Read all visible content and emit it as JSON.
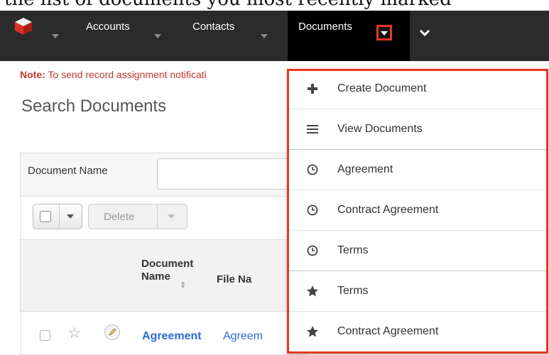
{
  "doc_text": "the list of documents you most recently marked",
  "nav": {
    "items": [
      "Accounts",
      "Contacts",
      "Documents"
    ]
  },
  "note": {
    "bold": "Note:",
    "text": " To send record assignment notificati"
  },
  "page_title": "Search Documents",
  "filter": {
    "label": "Document Name",
    "value": ""
  },
  "actions": {
    "delete_label": "Delete"
  },
  "table": {
    "headers": [
      "Document Name",
      "File Na"
    ],
    "rows": [
      {
        "name": "Agreement",
        "file": "Agreem"
      }
    ]
  },
  "menu": {
    "items": [
      {
        "label": "Create Document",
        "icon": "plus-icon"
      },
      {
        "label": "View Documents",
        "icon": "list-icon"
      },
      {
        "label": "Agreement",
        "icon": "clock-icon"
      },
      {
        "label": "Contract Agreement",
        "icon": "clock-icon"
      },
      {
        "label": "Terms",
        "icon": "clock-icon"
      },
      {
        "label": "Terms",
        "icon": "star-icon"
      },
      {
        "label": "Contract Agreement",
        "icon": "star-icon"
      }
    ]
  },
  "colors": {
    "highlight": "#e8361f",
    "navbar": "#2b2b2b",
    "link": "#2e6bcf",
    "note": "#c0392b"
  }
}
